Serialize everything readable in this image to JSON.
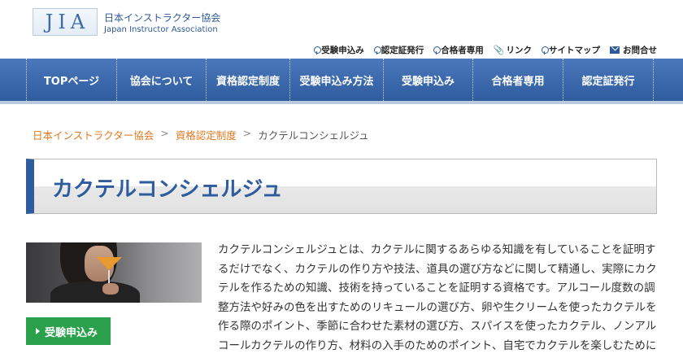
{
  "header": {
    "logo_text": "JIA",
    "org_name_ja": "日本インストラクター協会",
    "org_name_en": "Japan Instructor Association"
  },
  "utility_links": [
    {
      "label": "受験申込み",
      "icon": "pin-icon"
    },
    {
      "label": "認定証発行",
      "icon": "pin-icon"
    },
    {
      "label": "合格者専用",
      "icon": "pin-icon"
    },
    {
      "label": "リンク",
      "icon": "paperclip-icon"
    },
    {
      "label": "サイトマップ",
      "icon": "pin-icon"
    },
    {
      "label": "お問合せ",
      "icon": "mail-icon"
    }
  ],
  "nav": [
    {
      "label": "TOPページ"
    },
    {
      "label": "協会について"
    },
    {
      "label": "資格認定制度"
    },
    {
      "label": "受験申込み方法"
    },
    {
      "label": "受験申込み"
    },
    {
      "label": "合格者専用"
    },
    {
      "label": "認定証発行"
    }
  ],
  "breadcrumb": {
    "home": "日本インストラクター協会",
    "parent": "資格認定制度",
    "current": "カクテルコンシェルジュ",
    "separator": ">"
  },
  "page_title": "カクテルコンシェルジュ",
  "apply_button": "受験申込み",
  "description": "カクテルコンシェルジュとは、カクテルに関するあらゆる知識を有していることを証明するだけでなく、カクテルの作り方や技法、道具の選び方などに関して精通し、実際にカクテルを作るための知識、技術を持っていることを証明する資格です。アルコール度数の調整方法や好みの色を出すためのリキュールの選び方、卵や生クリームを使ったカクテルを作る際のポイント、季節に合わせた素材の選び方、スパイスを使ったカクテル、ノンアルコールカクテルの作り方、材料の入手のためのポイント、自宅でカクテルを楽しむために気を付けるべきポイントなど様々な知識や技法を学ぶことができます。",
  "colors": {
    "brand_blue": "#2e5c9e",
    "breadcrumb_orange": "#e07820",
    "button_green": "#2aa04a"
  }
}
